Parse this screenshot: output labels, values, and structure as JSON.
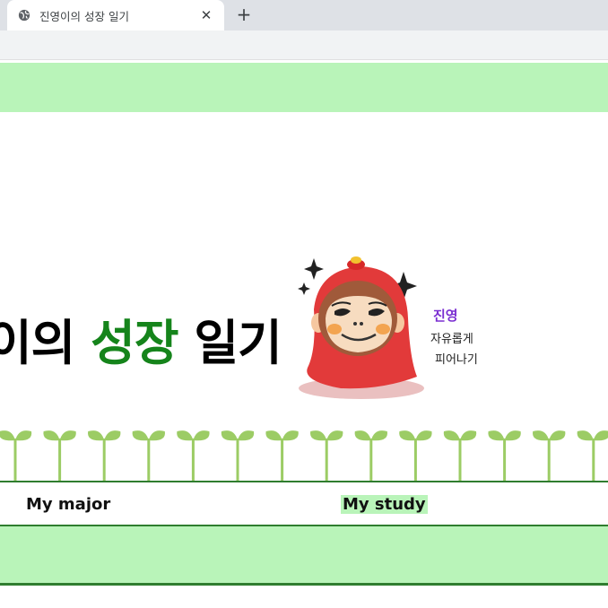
{
  "browser": {
    "tab_title": "진영이의 성장 일기",
    "new_tab_symbol": "+",
    "close_symbol": "✕"
  },
  "hero": {
    "title_part1": "이의 ",
    "title_highlight": "성장",
    "title_part2": " 일기"
  },
  "mascot": {
    "caption_line1": "진영",
    "caption_line2": "자유롭게",
    "caption_line3": "피어나기"
  },
  "nav": {
    "items": [
      {
        "label": "My major"
      },
      {
        "label": "My study"
      }
    ]
  },
  "colors": {
    "band_green": "#b9f4b9",
    "title_green": "#15841b",
    "line_green": "#2f7d2f",
    "sprout_green": "#9ccc65",
    "caption_purple": "#7b2fd1"
  },
  "icons": {
    "tab_icon": "globe-icon",
    "close_icon": "close-icon",
    "new_tab_icon": "plus-icon"
  }
}
